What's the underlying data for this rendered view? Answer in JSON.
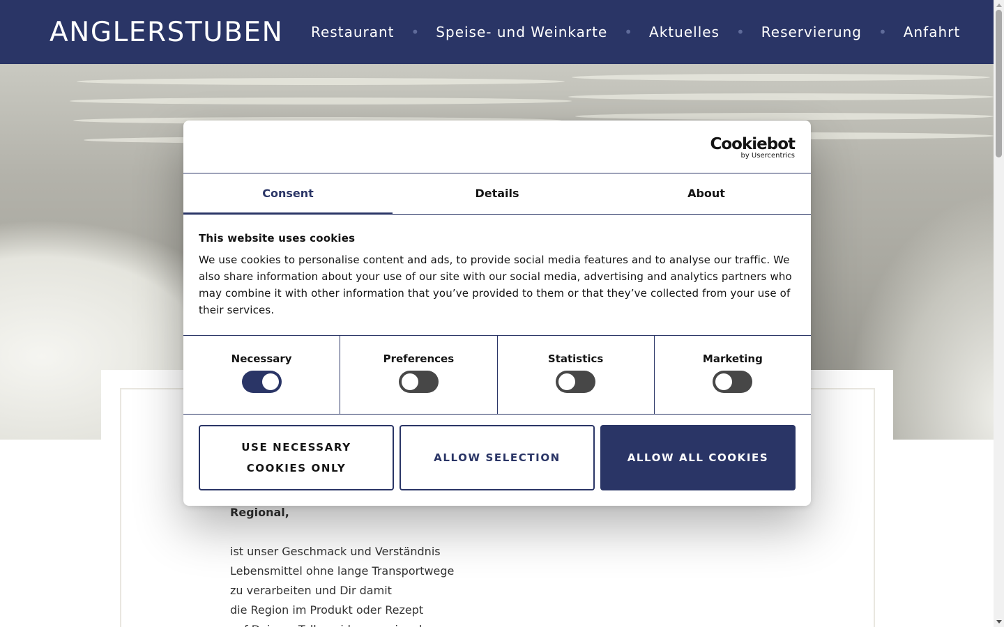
{
  "header": {
    "brand": "ANGLERSTUBEN",
    "nav": [
      "Restaurant",
      "Speise- und Weinkarte",
      "Aktuelles",
      "Reservierung",
      "Anfahrt"
    ],
    "separator": "•"
  },
  "content": {
    "heading": "Regional,",
    "lines": [
      "ist unser Geschmack und Verständnis",
      "Lebensmittel ohne lange Transportwege",
      "zu verarbeiten und Dir damit",
      "die Region im Produkt oder Rezept",
      "auf Deinem Teller wider zu spiegeln."
    ]
  },
  "cookie_dialog": {
    "logo_name": "Cookiebot",
    "logo_sub": "by Usercentrics",
    "tabs": [
      "Consent",
      "Details",
      "About"
    ],
    "active_tab": "Consent",
    "title": "This website uses cookies",
    "text": "We use cookies to personalise content and ads, to provide social media features and to analyse our traffic. We also share information about your use of our site with our social media, advertising and analytics partners who may combine it with other information that you’ve provided to them or that they’ve collected from your use of their services.",
    "toggles": [
      {
        "label": "Necessary",
        "on": true
      },
      {
        "label": "Preferences",
        "on": false
      },
      {
        "label": "Statistics",
        "on": false
      },
      {
        "label": "Marketing",
        "on": false
      }
    ],
    "buttons": {
      "necessary": "USE NECESSARY COOKIES ONLY",
      "selection": "ALLOW SELECTION",
      "all": "ALLOW ALL COOKIES"
    }
  },
  "colors": {
    "brand": "#2a3566",
    "text": "#141414"
  }
}
